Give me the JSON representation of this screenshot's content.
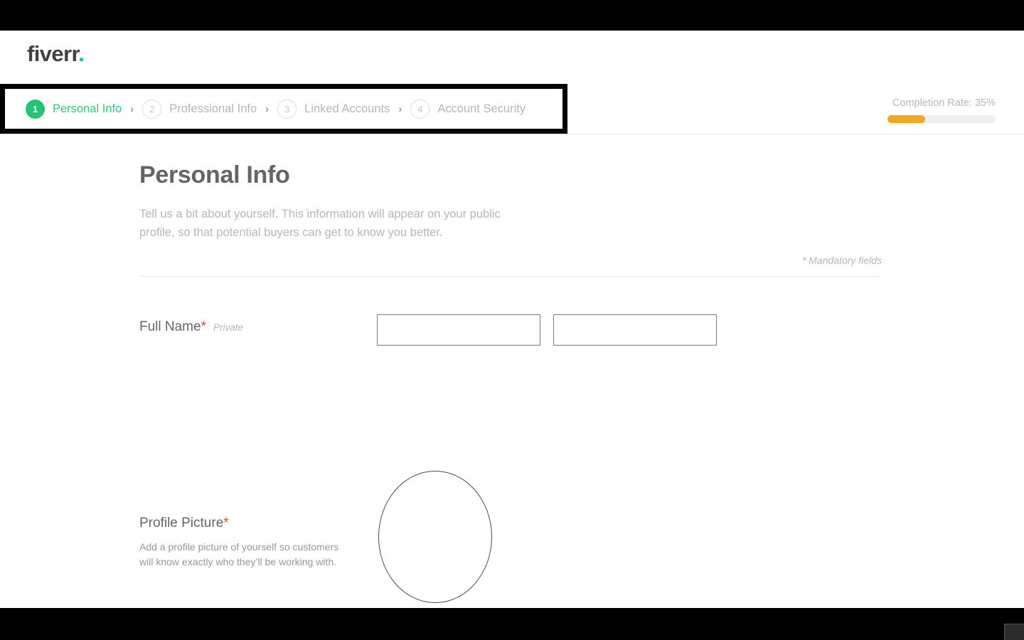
{
  "brand": {
    "logo_text": "fiverr",
    "logo_dot": ".",
    "green": "#1dbf73",
    "orange": "#f5a623",
    "required_red": "#e4472d"
  },
  "stepper": {
    "steps": [
      {
        "number": "1",
        "label": "Personal Info",
        "state": "active"
      },
      {
        "number": "2",
        "label": "Professional Info",
        "state": "inactive"
      },
      {
        "number": "3",
        "label": "Linked Accounts",
        "state": "inactive"
      },
      {
        "number": "4",
        "label": "Account Security",
        "state": "inactive"
      }
    ],
    "separator": "›"
  },
  "completion": {
    "label": "Completion Rate: 35%",
    "percent": 35
  },
  "main": {
    "title": "Personal Info",
    "description": "Tell us a bit about yourself. This information will appear on your public profile, so that potential buyers can get to know you better.",
    "mandatory_note": "* Mandatory fields"
  },
  "fields": {
    "full_name": {
      "label": "Full Name",
      "required_mark": "*",
      "note": "Private",
      "first_name_value": "",
      "first_name_placeholder": "",
      "last_name_value": "",
      "last_name_placeholder": ""
    },
    "profile_picture": {
      "label": "Profile Picture",
      "required_mark": "*",
      "help": "Add a profile picture of yourself so customers will know exactly who they’ll be working with.",
      "avatar_alt": "avatar-placeholder"
    }
  }
}
